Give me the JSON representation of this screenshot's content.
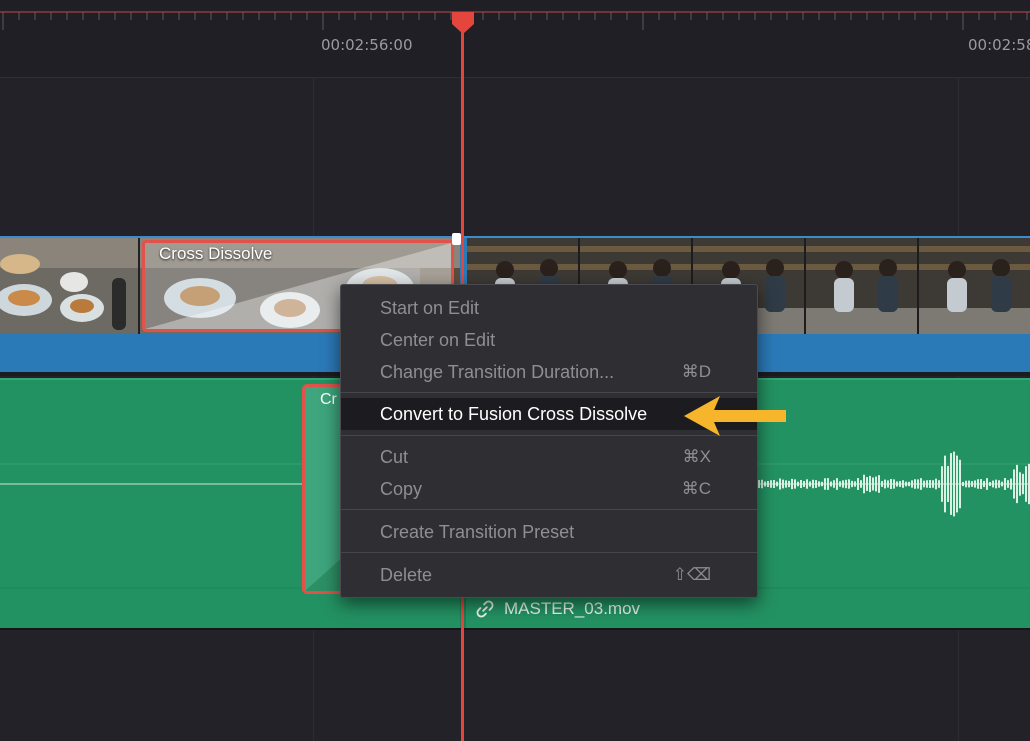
{
  "ruler": {
    "timecode_left": "00:02:56:00",
    "timecode_right": "00:02:58"
  },
  "video_track": {
    "transition_label": "Cross Dissolve"
  },
  "audio_track": {
    "transition_label_partial": "Cr",
    "clip_name": "MASTER_03.mov"
  },
  "context_menu": {
    "items": [
      {
        "label": "Start on Edit",
        "shortcut": ""
      },
      {
        "label": "Center on Edit",
        "shortcut": ""
      },
      {
        "label": "Change Transition Duration...",
        "shortcut": "⌘D"
      },
      {
        "label": "Convert to Fusion Cross Dissolve",
        "shortcut": ""
      },
      {
        "label": "Cut",
        "shortcut": "⌘X"
      },
      {
        "label": "Copy",
        "shortcut": "⌘C"
      },
      {
        "label": "Create Transition Preset",
        "shortcut": ""
      },
      {
        "label": "Delete",
        "shortcut": "⇧⌫"
      }
    ]
  },
  "colors": {
    "playhead": "#e4463e",
    "video_track": "#2b7ab8",
    "audio_track": "#239262",
    "annotation_arrow": "#f7b52c"
  },
  "icons": {
    "link": "link-icon",
    "playhead": "playhead-icon",
    "annotation": "arrow-left-icon"
  }
}
